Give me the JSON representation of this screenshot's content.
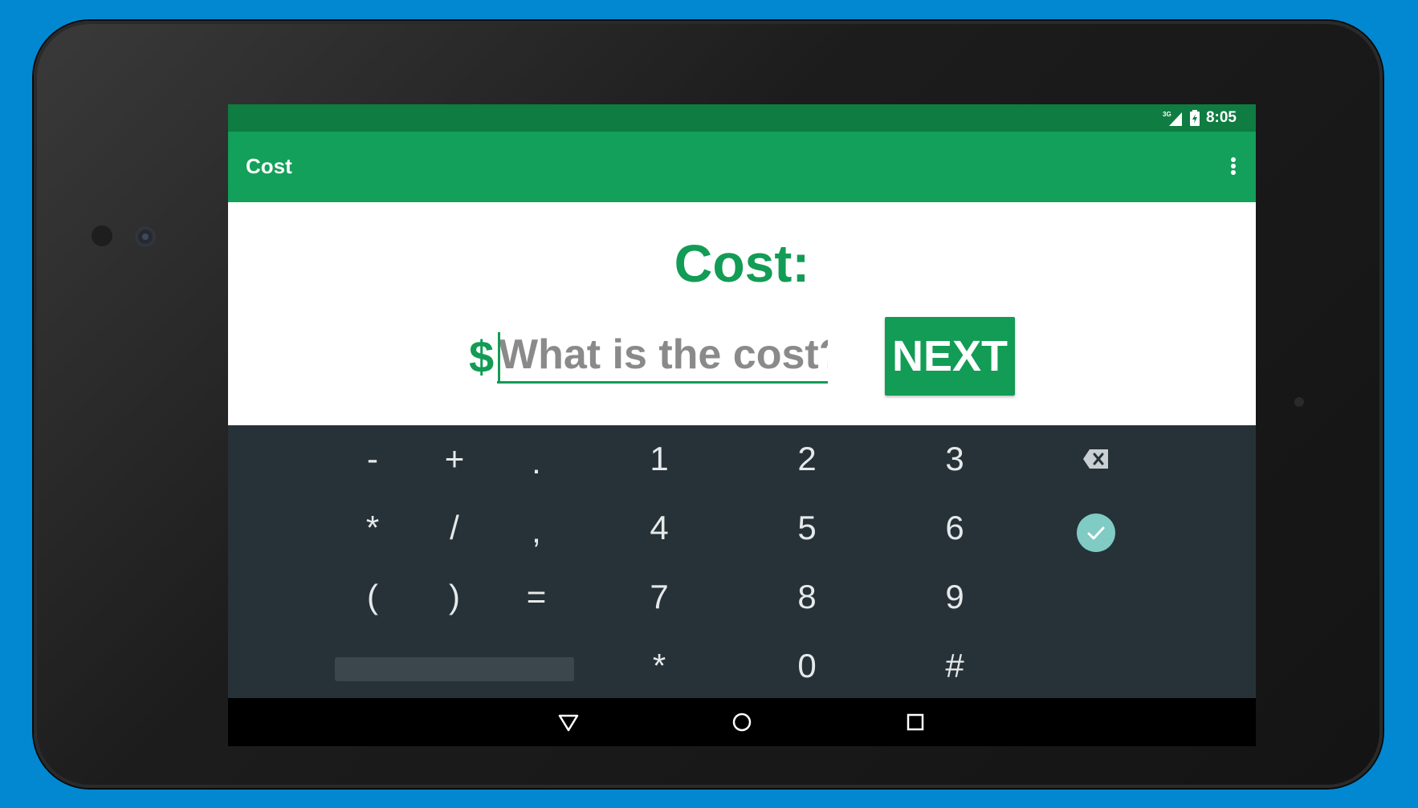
{
  "status_bar": {
    "time": "8:05",
    "network": "3G"
  },
  "app_bar": {
    "title": "Cost"
  },
  "main": {
    "heading": "Cost:",
    "currency_symbol": "$",
    "input_value": "",
    "input_placeholder": "What is the cost?",
    "next_label": "NEXT"
  },
  "keyboard": {
    "keys": {
      "minus": "-",
      "plus": "+",
      "period": ".",
      "one": "1",
      "two": "2",
      "three": "3",
      "asterisk": "*",
      "slash": "/",
      "comma": ",",
      "four": "4",
      "five": "5",
      "six": "6",
      "open_paren": "(",
      "close_paren": ")",
      "equals": "=",
      "seven": "7",
      "eight": "8",
      "nine": "9",
      "star": "*",
      "zero": "0",
      "hash": "#"
    },
    "backspace_icon": "backspace-icon",
    "done_icon": "checkmark-icon"
  },
  "navigation": {
    "back_icon": "back-triangle-icon",
    "home_icon": "home-circle-icon",
    "recents_icon": "recents-square-icon"
  },
  "colors": {
    "status_bar": "#0f7c41",
    "app_bar": "#13a05a",
    "accent": "#129c55",
    "keyboard": "#263238",
    "done_key": "#80cbc4",
    "background": "#0288d1"
  }
}
